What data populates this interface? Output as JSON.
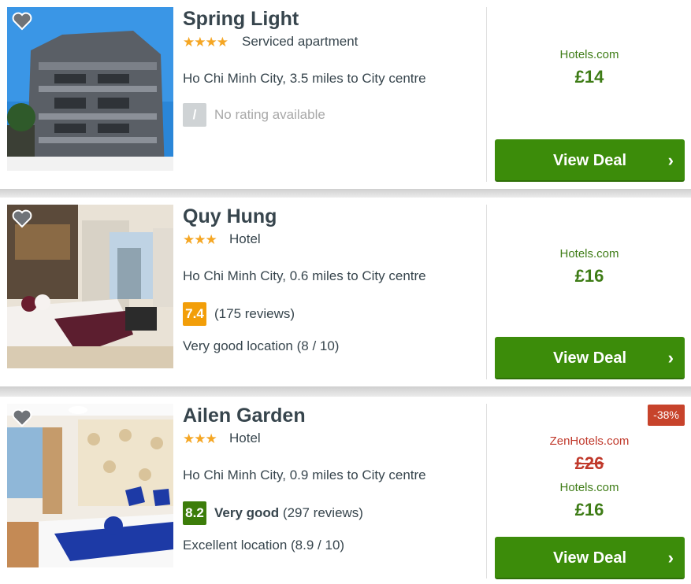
{
  "hotels": [
    {
      "name": "Spring Light",
      "stars": "★★★★",
      "type": "Serviced apartment",
      "location": "Ho Chi Minh City, 3.5 miles to City centre",
      "score": "/",
      "rating_label": "",
      "rating_text": "No rating available",
      "location_rating": "",
      "deals": [
        {
          "provider": "Hotels.com",
          "price": "£14"
        }
      ],
      "button": "View Deal"
    },
    {
      "name": "Quy Hung",
      "stars": "★★★",
      "type": "Hotel",
      "location": "Ho Chi Minh City, 0.6 miles to City centre",
      "score": "7.4",
      "rating_label": "",
      "rating_text": "(175 reviews)",
      "location_rating": "Very good location (8 / 10)",
      "deals": [
        {
          "provider": "Hotels.com",
          "price": "£16"
        }
      ],
      "button": "View Deal"
    },
    {
      "name": "Ailen Garden",
      "stars": "★★★",
      "type": "Hotel",
      "location": "Ho Chi Minh City, 0.9 miles to City centre",
      "score": "8.2",
      "rating_label": "Very good",
      "rating_text": "(297 reviews)",
      "location_rating": "Excellent location (8.9 / 10)",
      "discount": "-38%",
      "deals": [
        {
          "provider": "ZenHotels.com",
          "price": "£26"
        },
        {
          "provider": "Hotels.com",
          "price": "£16"
        }
      ],
      "button": "View Deal"
    }
  ],
  "colors": {
    "accent_green": "#3c8c0a",
    "price_green": "#3e7c16",
    "star_orange": "#f5a623",
    "discount_red": "#c7432b",
    "score_orange": "#f29e09",
    "score_green": "#3c7d0a"
  },
  "icons": {
    "favorite": "heart-icon",
    "chevron": "chevron-right-icon"
  }
}
